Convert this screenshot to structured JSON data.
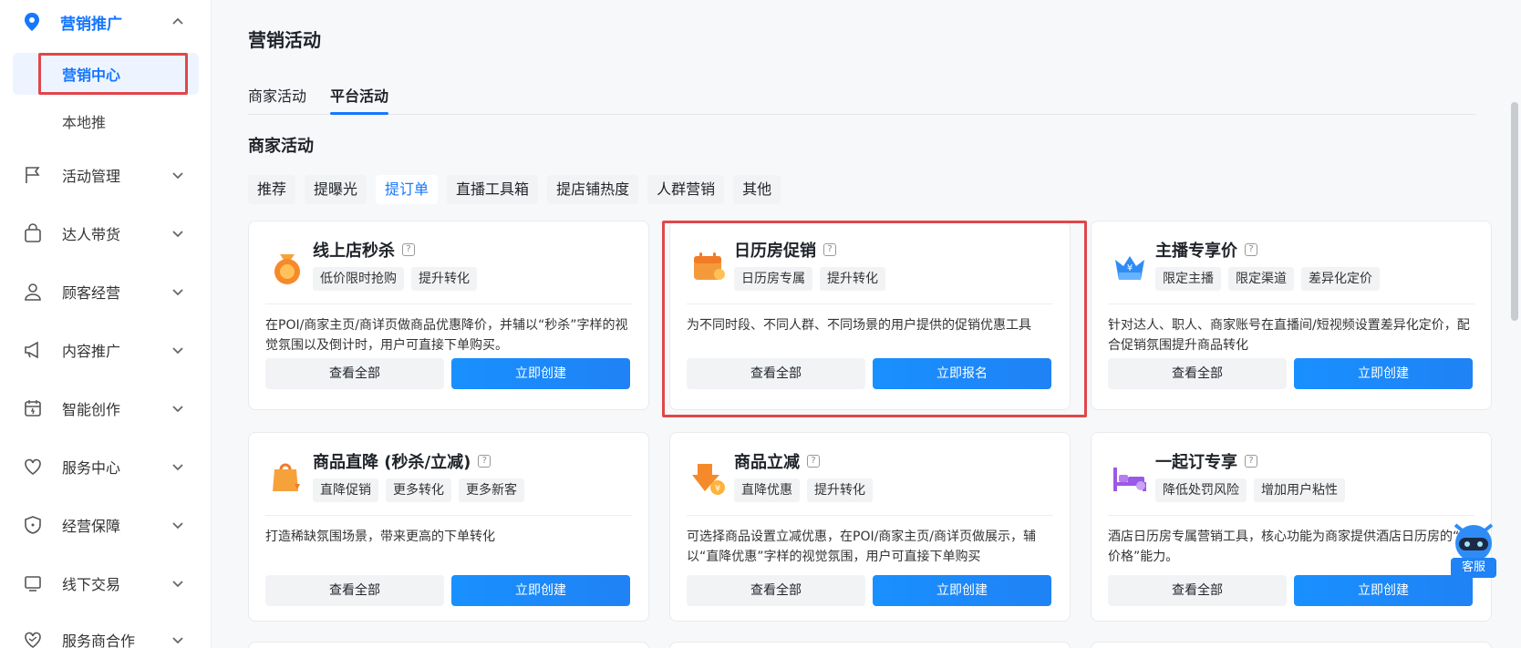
{
  "sidebar": {
    "top_label": "营销推广",
    "active_sub": "营销中心",
    "local_sub": "本地推",
    "items": [
      {
        "label": "活动管理",
        "icon": "flag-icon"
      },
      {
        "label": "达人带货",
        "icon": "shopping-bag-icon"
      },
      {
        "label": "顾客经营",
        "icon": "user-icon"
      },
      {
        "label": "内容推广",
        "icon": "megaphone-icon"
      },
      {
        "label": "智能创作",
        "icon": "calendar-spark-icon"
      },
      {
        "label": "服务中心",
        "icon": "heart-icon"
      },
      {
        "label": "经营保障",
        "icon": "shield-icon"
      },
      {
        "label": "线下交易",
        "icon": "monitor-icon"
      },
      {
        "label": "服务商合作",
        "icon": "handshake-heart-icon"
      }
    ]
  },
  "page": {
    "title": "营销活动",
    "tabs": [
      "商家活动",
      "平台活动"
    ],
    "section_title": "商家活动",
    "chips": [
      "推荐",
      "提曝光",
      "提订单",
      "直播工具箱",
      "提店铺热度",
      "人群营销",
      "其他"
    ]
  },
  "cards": [
    {
      "title": "线上店秒杀",
      "tags": [
        "低价限时抢购",
        "提升转化"
      ],
      "desc": "在POI/商家主页/商详页做商品优惠降价，并辅以“秒杀”字样的视觉氛围以及倒计时，用户可直接下单购买。",
      "btn_secondary": "查看全部",
      "btn_primary": "立即创建"
    },
    {
      "title": "日历房促销",
      "tags": [
        "日历房专属",
        "提升转化"
      ],
      "desc": "为不同时段、不同人群、不同场景的用户提供的促销优惠工具",
      "btn_secondary": "查看全部",
      "btn_primary": "立即报名"
    },
    {
      "title": "主播专享价",
      "tags": [
        "限定主播",
        "限定渠道",
        "差异化定价"
      ],
      "desc": "针对达人、职人、商家账号在直播间/短视频设置差异化定价，配合促销氛围提升商品转化",
      "btn_secondary": "查看全部",
      "btn_primary": "立即创建"
    },
    {
      "title": "商品直降 (秒杀/立减)",
      "tags": [
        "直降促销",
        "更多转化",
        "更多新客"
      ],
      "desc": "打造稀缺氛围场景，带来更高的下单转化",
      "btn_secondary": "查看全部",
      "btn_primary": "立即创建"
    },
    {
      "title": "商品立减",
      "tags": [
        "直降优惠",
        "提升转化"
      ],
      "desc": "可选择商品设置立减优惠，在POI/商家主页/商详页做展示，辅以“直降优惠”字样的视觉氛围，用户可直接下单购买",
      "btn_secondary": "查看全部",
      "btn_primary": "立即创建"
    },
    {
      "title": "一起订专享",
      "tags": [
        "降低处罚风险",
        "增加用户粘性"
      ],
      "desc": "酒店日历房专属营销工具，核心功能为商家提供酒店日历房的“纱价格”能力。",
      "btn_secondary": "查看全部",
      "btn_primary": "立即创建"
    }
  ],
  "support": {
    "label": "客服"
  },
  "colors": {
    "accent": "#1677ff",
    "highlight": "#e0474b"
  }
}
